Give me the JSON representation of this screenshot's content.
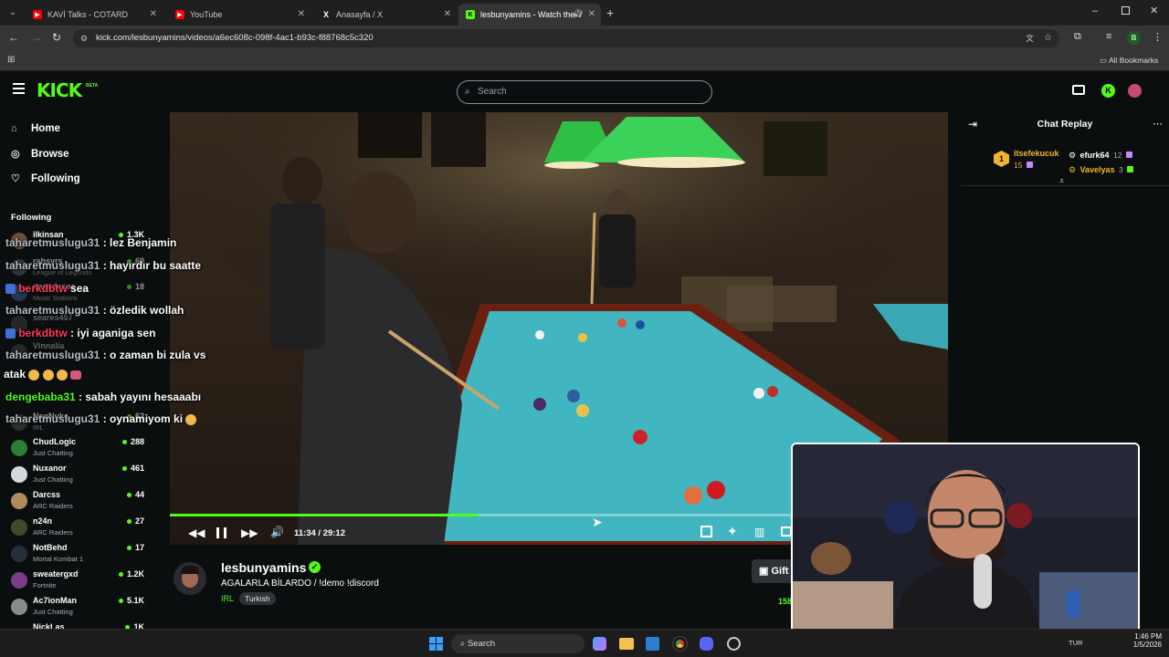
{
  "browser": {
    "tabs": [
      {
        "title": "KAVİ Talks - COTARD"
      },
      {
        "title": "YouTube"
      },
      {
        "title": "Anasayfa / X"
      },
      {
        "title": "lesbunyamins - Watch the V"
      }
    ],
    "url": "kick.com/lesbunyamins/videos/a6ec608c-098f-4ac1-b93c-f88768c5c320",
    "profile_initial": "B",
    "bookmarks_label": "All Bookmarks"
  },
  "header": {
    "logo": "KICK",
    "beta": "BETA",
    "search_placeholder": "Search"
  },
  "sidebar": {
    "nav": [
      {
        "label": "Home",
        "icon": "home-icon"
      },
      {
        "label": "Browse",
        "icon": "compass-icon"
      },
      {
        "label": "Following",
        "icon": "heart-icon"
      }
    ],
    "following_heading": "Following",
    "channels": [
      {
        "name": "ilkinsan",
        "game": "",
        "viewers": "1.3K"
      },
      {
        "name": "rahsyrs",
        "game": "League of Legends",
        "viewers": "69"
      },
      {
        "name": "ensodesea",
        "game": "Music Stations",
        "viewers": "18"
      },
      {
        "name": "seares457",
        "game": "",
        "viewers": ""
      },
      {
        "name": "Vinnalia",
        "game": "",
        "viewers": ""
      },
      {
        "name": "dengebaba31",
        "game": "",
        "viewers": ""
      },
      {
        "name": "NeoNuke",
        "game": "IRL",
        "viewers": "62"
      },
      {
        "name": "ChudLogic",
        "game": "Just Chatting",
        "viewers": "288"
      },
      {
        "name": "Nuxanor",
        "game": "Just Chatting",
        "viewers": "461"
      },
      {
        "name": "Darcss",
        "game": "ARC Raiders",
        "viewers": "44"
      },
      {
        "name": "n24n",
        "game": "ARC Raiders",
        "viewers": "27"
      },
      {
        "name": "NotBehd",
        "game": "Mortal Kombat 1",
        "viewers": "17"
      },
      {
        "name": "sweatergxd",
        "game": "Fortnite",
        "viewers": "1.2K"
      },
      {
        "name": "Ac7ionMan",
        "game": "Just Chatting",
        "viewers": "5.1K"
      },
      {
        "name": "NickLas",
        "game": "",
        "viewers": "1K"
      }
    ]
  },
  "chat_overlay": [
    {
      "user": "taharetmuslugu31",
      "text": "lez Benjamin",
      "user_color": "#b7bcc0"
    },
    {
      "user": "taharetmuslugu31",
      "text": "hayırdır bu saatte",
      "user_color": "#b7bcc0"
    },
    {
      "user": "berkdbtw",
      "text": "sea",
      "user_color": "#ff3b57"
    },
    {
      "user": "taharetmuslugu31",
      "text": "özledik wollah",
      "user_color": "#b7bcc0"
    },
    {
      "user": "berkdbtw",
      "text": "iyi aganiga sen",
      "user_color": "#ff3b57"
    },
    {
      "user": "taharetmuslugu31",
      "text": "o zaman bi zula vs",
      "user_color": "#b7bcc0"
    },
    {
      "user": "",
      "text": "atak",
      "user_color": "#ffffff"
    },
    {
      "user": "dengebaba31",
      "text": "sabah yayını hesaaabı",
      "user_color": "#53fc18"
    },
    {
      "user": "taharetmuslugu31",
      "text": "oynamiyom ki",
      "user_color": "#b7bcc0"
    }
  ],
  "player": {
    "time": "11:34 / 29:12",
    "progress": 0.397
  },
  "stream": {
    "channel": "lesbunyamins",
    "title": "AGALARLA BİLARDO  / !demo !discord",
    "category": "IRL",
    "tag": "Turkish",
    "gift_label": "Gift",
    "count_partial": "158"
  },
  "chat_panel": {
    "title": "Chat Replay",
    "leaders": [
      {
        "rank": "1",
        "name": "itsefekucuk",
        "value": "15"
      },
      {
        "rank": "",
        "name": "efurk64",
        "value": "12"
      },
      {
        "rank": "",
        "name": "Vavelyas",
        "value": "3"
      }
    ]
  },
  "taskbar": {
    "search_label": "Search",
    "tray_lang": "TUR",
    "time": "1:46 PM",
    "date": "1/5/2026"
  },
  "colors": {
    "kick_green": "#53fc18",
    "background": "#0b0e0f",
    "pool_cloth": "#3fb3bd"
  }
}
